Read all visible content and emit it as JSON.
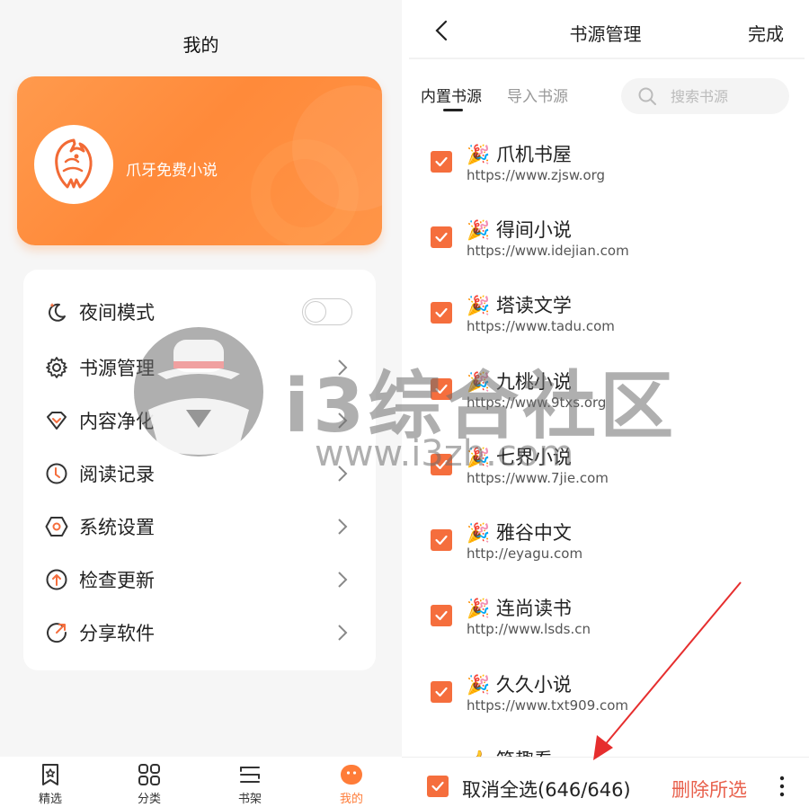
{
  "left_panel": {
    "title": "我的",
    "profile": {
      "name": "爪牙免费小说"
    },
    "menu": {
      "night_mode": {
        "label": "夜间模式",
        "enabled": false
      },
      "items": [
        {
          "label": "书源管理",
          "icon": "gear-icon"
        },
        {
          "label": "内容净化",
          "icon": "diamond-icon"
        },
        {
          "label": "阅读记录",
          "icon": "clock-icon"
        },
        {
          "label": "系统设置",
          "icon": "hexagon-settings-icon"
        },
        {
          "label": "检查更新",
          "icon": "arrow-up-circle-icon"
        },
        {
          "label": "分享软件",
          "icon": "share-icon"
        }
      ]
    },
    "bottom_nav": [
      {
        "label": "精选",
        "icon": "star-bookmark-icon",
        "active": false
      },
      {
        "label": "分类",
        "icon": "grid-icon",
        "active": false
      },
      {
        "label": "书架",
        "icon": "bookshelf-icon",
        "active": false
      },
      {
        "label": "我的",
        "icon": "face-icon",
        "active": true
      }
    ]
  },
  "right_panel": {
    "title": "书源管理",
    "done_label": "完成",
    "tabs": [
      {
        "label": "内置书源",
        "active": true
      },
      {
        "label": "导入书源",
        "active": false
      }
    ],
    "search_placeholder": "搜索书源",
    "sources": [
      {
        "emoji": "🎉",
        "name": "爪机书屋",
        "url": "https://www.zjsw.org",
        "checked": true
      },
      {
        "emoji": "🎉",
        "name": "得间小说",
        "url": "https://www.idejian.com",
        "checked": true
      },
      {
        "emoji": "🎉",
        "name": "塔读文学",
        "url": "https://www.tadu.com",
        "checked": true
      },
      {
        "emoji": "🎉",
        "name": "九桃小说",
        "url": "https://www.9txs.org",
        "checked": true
      },
      {
        "emoji": "🎉",
        "name": "七界小说",
        "url": "https://www.7jie.com",
        "checked": true
      },
      {
        "emoji": "🎉",
        "name": "雅谷中文",
        "url": "http://eyagu.com",
        "checked": true
      },
      {
        "emoji": "🎉",
        "name": "连尚读书",
        "url": "http://www.lsds.cn",
        "checked": true
      },
      {
        "emoji": "🎉",
        "name": "久久小说",
        "url": "https://www.txt909.com",
        "checked": true
      },
      {
        "emoji": "👍",
        "name": "笔趣看",
        "url": "",
        "checked": true
      }
    ],
    "bottom_bar": {
      "select_all_label": "取消全选(646/646)",
      "delete_label": "删除所选"
    }
  },
  "watermark": {
    "text": "i3综合社区",
    "url": "www.i3zh.com"
  },
  "colors": {
    "accent": "#ff8a3a",
    "checkbox": "#f56e3d",
    "delete": "#e8604c"
  }
}
